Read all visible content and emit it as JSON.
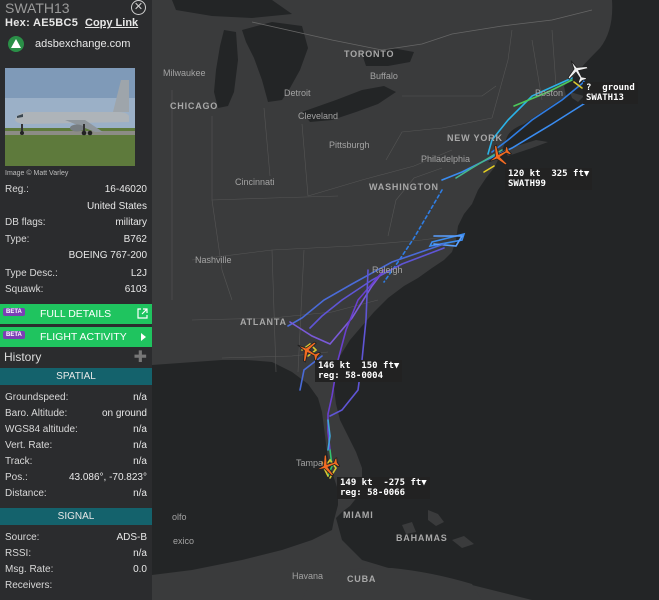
{
  "sidebar": {
    "callsign": "SWATH13",
    "hex_label": "Hex:",
    "hex_value": "AE5BC5",
    "copy_link": "Copy Link",
    "adsbx_url": "adsbexchange.com",
    "photo_credit": "Image © Matt Varley",
    "details": [
      {
        "key": "Reg.:",
        "value": "16-46020"
      },
      {
        "key": "",
        "value": "United States"
      },
      {
        "key": "DB flags:",
        "value": "military"
      },
      {
        "key": "Type:",
        "value": "B762"
      },
      {
        "key": "",
        "value": "BOEING 767-200"
      },
      {
        "key": "Type Desc.:",
        "value": "L2J"
      },
      {
        "key": "Squawk:",
        "value": "6103"
      }
    ],
    "beta": "BETA",
    "full_details": "FULL DETAILS",
    "flight_activity": "FLIGHT ACTIVITY",
    "history": "History",
    "spatial_header": "SPATIAL",
    "spatial": [
      {
        "key": "Groundspeed:",
        "value": "n/a"
      },
      {
        "key": "Baro. Altitude:",
        "value": "on ground"
      },
      {
        "key": "WGS84 altitude:",
        "value": "n/a"
      },
      {
        "key": "Vert. Rate:",
        "value": "n/a"
      },
      {
        "key": "Track:",
        "value": "n/a"
      },
      {
        "key": "Pos.:",
        "value": "43.086°, -70.823°"
      },
      {
        "key": "Distance:",
        "value": "n/a"
      }
    ],
    "signal_header": "SIGNAL",
    "signal": [
      {
        "key": "Source:",
        "value": "ADS-B"
      },
      {
        "key": "RSSI:",
        "value": "n/a"
      },
      {
        "key": "Msg. Rate:",
        "value": "0.0"
      },
      {
        "key": "Receivers:",
        "value": ""
      }
    ]
  },
  "map": {
    "labels": [
      {
        "text": "Toronto",
        "style": "city"
      },
      {
        "text": "Milwaukee",
        "style": "small"
      },
      {
        "text": "Buffalo",
        "style": "small"
      },
      {
        "text": "Chicago",
        "style": "city"
      },
      {
        "text": "Detroit",
        "style": "small"
      },
      {
        "text": "Boston",
        "style": "small"
      },
      {
        "text": "Cleveland",
        "style": "small"
      },
      {
        "text": "Pittsburgh",
        "style": "small"
      },
      {
        "text": "New York",
        "style": "city"
      },
      {
        "text": "Philadelphia",
        "style": "small"
      },
      {
        "text": "Cincinnati",
        "style": "small"
      },
      {
        "text": "Washington",
        "style": "city"
      },
      {
        "text": "Nashville",
        "style": "small"
      },
      {
        "text": "Raleigh",
        "style": "small"
      },
      {
        "text": "Atlanta",
        "style": "city"
      },
      {
        "text": "Tampa",
        "style": "small"
      },
      {
        "text": "Miami",
        "style": "city"
      },
      {
        "text": "Bahamas",
        "style": "city"
      },
      {
        "text": "Havana",
        "style": "small"
      },
      {
        "text": "Cuba",
        "style": "city"
      },
      {
        "text": "olfo",
        "style": "small"
      },
      {
        "text": "exico",
        "style": "small"
      }
    ],
    "aircraft": [
      {
        "name": "SWATH13",
        "line1": "?  ground",
        "line2": "SWATH13",
        "color": "#f0f0f0"
      },
      {
        "name": "SWATH99",
        "line1": "120 kt  325 ft▼",
        "line2": "SWATH99",
        "color": "#f26b22"
      },
      {
        "name": "58-0004",
        "line1": "146 kt  150 ft▼",
        "line2": "reg: 58-0004",
        "color": "#f26b22"
      },
      {
        "name": "58-0066",
        "line1": "149 kt  -275 ft▼",
        "line2": "reg: 58-0066",
        "color": "#f26b22"
      }
    ]
  }
}
